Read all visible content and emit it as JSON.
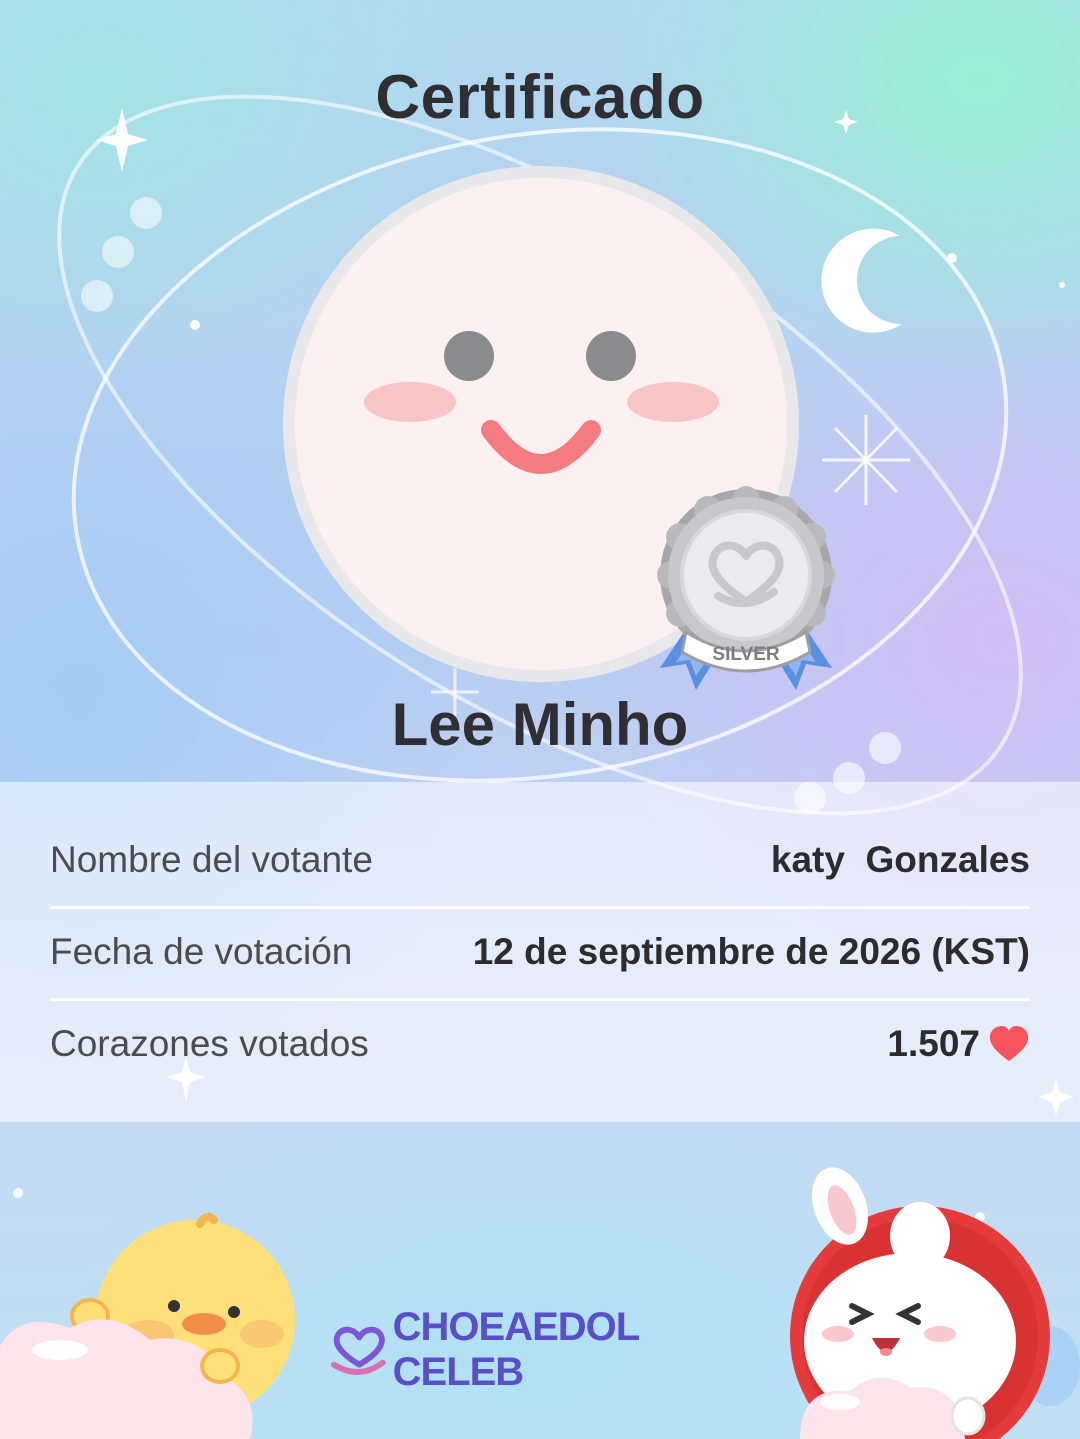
{
  "certificate": {
    "title": "Certificado",
    "celebrity_name": "Lee Minho",
    "badge_label": "SILVER"
  },
  "details": [
    {
      "label": "Nombre del votante",
      "value": "katy  Gonzales"
    },
    {
      "label": "Fecha de votación",
      "value": "12 de septiembre de 2026 (KST)"
    },
    {
      "label": "Corazones votados",
      "value": "1.507"
    }
  ],
  "brand": {
    "name": "CHOEAEDOL CELEB"
  },
  "colors": {
    "title_text": "#2f2f33",
    "heart": "#f4545b",
    "brand": "#5b4fc8",
    "badge_ribbon": "#5b8fe0",
    "avatar_bg": "#fdf0f0"
  },
  "icons": {
    "heart": "heart-icon",
    "brand_logo": "heart-logo-icon",
    "moon": "crescent-moon-icon",
    "sparkle": "sparkle-icon"
  }
}
